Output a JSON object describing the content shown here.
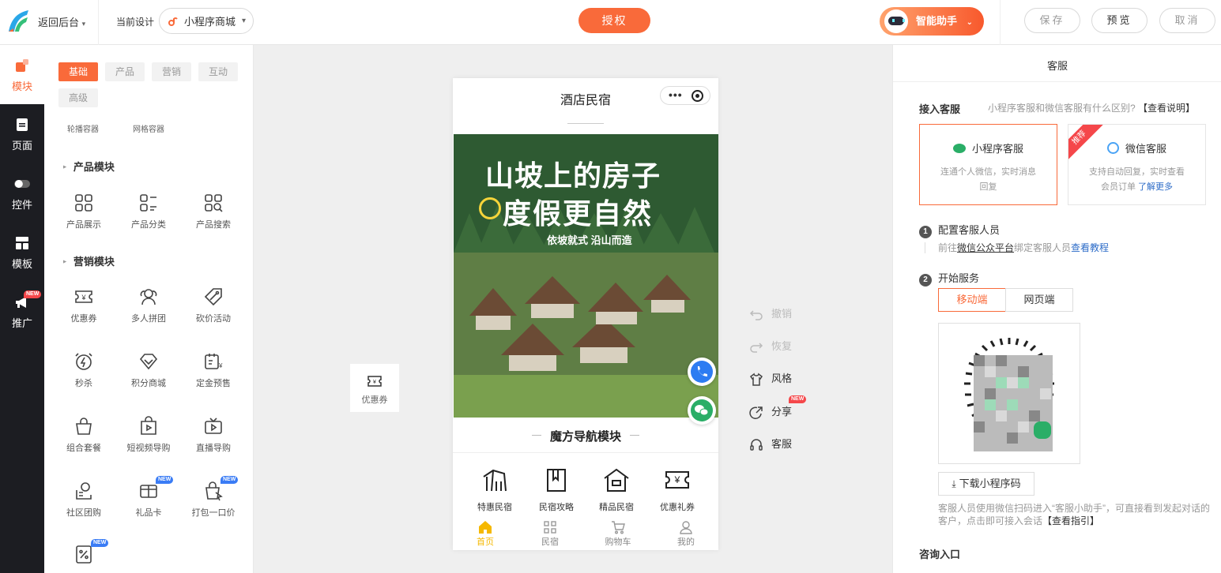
{
  "topbar": {
    "back_label": "返回后台",
    "current_design_label": "当前设计",
    "design_name": "小程序商城",
    "authorize": "授权",
    "assistant": "智能助手",
    "save": "保存",
    "preview": "预览",
    "cancel": "取消"
  },
  "rail": {
    "items": [
      {
        "label": "模块"
      },
      {
        "label": "页面"
      },
      {
        "label": "控件"
      },
      {
        "label": "模板"
      },
      {
        "label": "推广",
        "badge": "NEW"
      }
    ]
  },
  "panel": {
    "tabs": [
      "基础",
      "产品",
      "营销",
      "互动",
      "高级"
    ],
    "containers": [
      "轮播容器",
      "网格容器"
    ],
    "product_section": "产品模块",
    "product_modules": [
      "产品展示",
      "产品分类",
      "产品搜索"
    ],
    "marketing_section": "营销模块",
    "marketing_modules": [
      {
        "label": "优惠券",
        "icon": "coupon-icon"
      },
      {
        "label": "多人拼团",
        "icon": "group-buy-icon"
      },
      {
        "label": "砍价活动",
        "icon": "bargain-icon"
      },
      {
        "label": "秒杀",
        "icon": "flash-sale-icon"
      },
      {
        "label": "积分商城",
        "icon": "points-mall-icon"
      },
      {
        "label": "定金预售",
        "icon": "presale-icon"
      },
      {
        "label": "组合套餐",
        "icon": "bundle-icon"
      },
      {
        "label": "短视频导购",
        "icon": "short-video-icon"
      },
      {
        "label": "直播导购",
        "icon": "live-stream-icon"
      },
      {
        "label": "社区团购",
        "icon": "community-buy-icon"
      },
      {
        "label": "礼品卡",
        "icon": "gift-card-icon",
        "badge": "NEW"
      },
      {
        "label": "打包一口价",
        "icon": "bundle-price-icon",
        "badge": "NEW"
      }
    ],
    "last_badge": "NEW"
  },
  "canvas": {
    "side_coupon": "优惠券",
    "phone_title": "酒店民宿",
    "hero_line1": "山坡上的房子",
    "hero_line2": "度假更自然",
    "hero_line3": "依坡就式 沿山而造",
    "nav_heading": "魔方导航模块",
    "nav_items": [
      "特惠民宿",
      "民宿攻略",
      "精品民宿",
      "优惠礼券"
    ],
    "tabbar": [
      "首页",
      "民宿",
      "购物车",
      "我的"
    ],
    "accent": "#f5b800"
  },
  "tools": {
    "undo": "撤销",
    "redo": "恢复",
    "style": "风格",
    "share": "分享",
    "share_badge": "NEW",
    "service": "客服"
  },
  "right": {
    "title": "客服",
    "access_label": "接入客服",
    "access_help": "小程序客服和微信客服有什么区别?",
    "access_help_link": "【查看说明】",
    "card1_title": "小程序客服",
    "card1_desc": "连通个人微信，实时消息回复",
    "card2_title": "微信客服",
    "card2_ribbon": "推荐",
    "card2_desc": "支持自动回复，实时查看会员订单",
    "card2_more": "了解更多",
    "step1": "配置客服人员",
    "step1_desc_pre": "前往",
    "step1_link1": "微信公众平台",
    "step1_desc_mid": "绑定客服人员",
    "step1_link2": "查看教程",
    "step2": "开始服务",
    "seg_mobile": "移动端",
    "seg_web": "网页端",
    "download": "下载小程序码",
    "note": "客服人员使用微信扫码进入“客服小助手”，可直接看到发起对话的客户，点击即可接入会话",
    "note_link": "【查看指引】",
    "consult_label": "咨询入口"
  },
  "colors": {
    "brand": "#f96a3a",
    "wechat_green": "#2aae67",
    "link": "#2d6cc8"
  }
}
